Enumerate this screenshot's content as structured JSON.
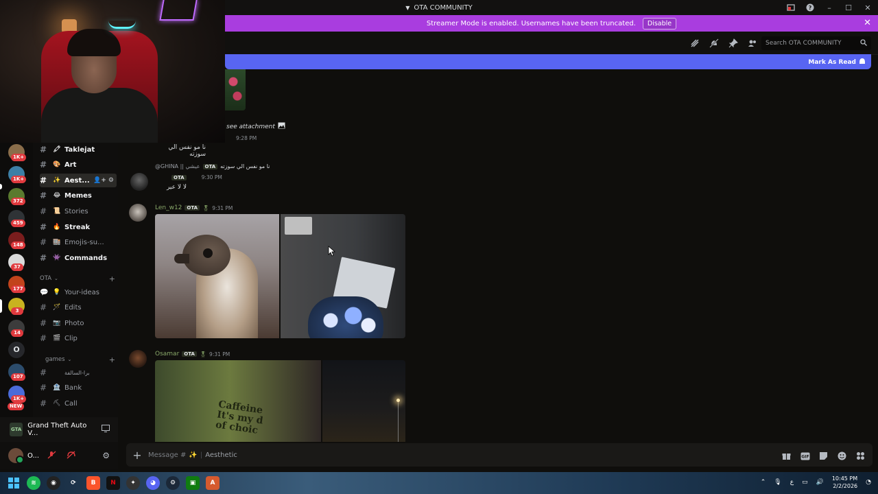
{
  "titlebar": {
    "title": "OTA COMMUNITY"
  },
  "banner": {
    "text": "Streamer Mode is enabled. Usernames have been truncated.",
    "disable_label": "Disable",
    "color": "#a93ddf"
  },
  "header": {
    "search_placeholder": "Search OTA COMMUNITY"
  },
  "unread": {
    "label": "Mark As Read",
    "color": "#5865f2"
  },
  "rail": {
    "badges": [
      "1K+",
      "1K+",
      "372",
      "459",
      "148",
      "37",
      "177",
      "3",
      "14",
      "107",
      "1K+"
    ],
    "letter_server": "O",
    "new_label": "NEW"
  },
  "channels": {
    "items": [
      {
        "emoji": "🖍",
        "label": "Taklejat"
      },
      {
        "emoji": "🎨",
        "label": "Art"
      },
      {
        "emoji": "✨",
        "label": "Aest..."
      },
      {
        "emoji": "😂",
        "label": "Memes"
      },
      {
        "emoji": "📜",
        "label": "Stories"
      },
      {
        "emoji": "🔥",
        "label": "Streak"
      },
      {
        "emoji": "🏬",
        "label": "Emojis-su..."
      },
      {
        "emoji": "👾",
        "label": "Commands"
      }
    ],
    "cat_ota": "OTA",
    "ota_items": [
      {
        "emoji": "💡",
        "label": "Your-ideas"
      },
      {
        "emoji": "🪄",
        "label": "Edits"
      },
      {
        "emoji": "📷",
        "label": "Photo"
      },
      {
        "emoji": "🎬",
        "label": "Clip"
      }
    ],
    "cat_games": "games",
    "games_items": [
      {
        "emoji": "",
        "label": "برا-السالفة"
      },
      {
        "emoji": "🏦",
        "label": "Bank"
      },
      {
        "emoji": "⛏",
        "label": "Call"
      }
    ]
  },
  "activity": {
    "game_title": "Grand Theft Auto V...",
    "icon_label": "GTA"
  },
  "user": {
    "name": "O..."
  },
  "messages": {
    "attachment_text": "see attachment",
    "m1_time": "9:28 PM",
    "m1_text": "نا مو نفس الي سوزته",
    "reply_user": "@GHINA || عيشي",
    "reply_tag": "OTA",
    "reply_text": "نا مو نفس الي سوزته",
    "m2_tag": "OTA",
    "m2_time": "9:30 PM",
    "m2_text": "لا لا عير",
    "m3_user": "Len_w12",
    "m3_tag": "OTA",
    "m3_time": "9:31 PM",
    "m4_user": "Osamar",
    "m4_tag": "OTA",
    "m4_time": "9:31 PM",
    "cup_text": "Caffeine\nIt's my d\nof choic"
  },
  "composer": {
    "placeholder_prefix": "Message #",
    "emoji": "✨",
    "channel": "Aesthetic"
  },
  "taskbar": {
    "time": "10:45 PM",
    "date": "2/2/2026",
    "lang": "ع"
  }
}
